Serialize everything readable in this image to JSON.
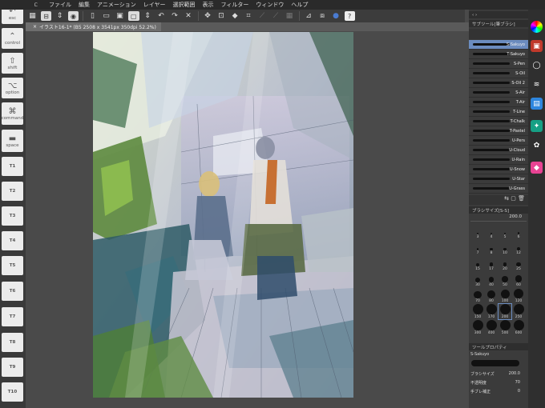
{
  "menubar": {
    "items": [
      "ファイル",
      "編集",
      "アニメーション",
      "レイヤー",
      "選択範囲",
      "表示",
      "フィルター",
      "ウィンドウ",
      "ヘルプ"
    ]
  },
  "document": {
    "tab_title": "イラスト16-1* (B5 2508 x 3541px 350dpi 52.2%)",
    "close": "×"
  },
  "leftbar": {
    "keys": [
      {
        "icon": "↶",
        "label": "esc"
      },
      {
        "icon": "⌃",
        "label": "control"
      },
      {
        "icon": "⇧",
        "label": "shift"
      },
      {
        "icon": "⌥",
        "label": "option"
      },
      {
        "icon": "⌘",
        "label": "command"
      },
      {
        "icon": "▬",
        "label": "space"
      },
      {
        "icon": "",
        "label": "T1"
      },
      {
        "icon": "",
        "label": "T2"
      },
      {
        "icon": "",
        "label": "T3"
      },
      {
        "icon": "",
        "label": "T4"
      },
      {
        "icon": "",
        "label": "T5"
      },
      {
        "icon": "",
        "label": "T6"
      },
      {
        "icon": "",
        "label": "T7"
      },
      {
        "icon": "",
        "label": "T8"
      },
      {
        "icon": "",
        "label": "T9"
      },
      {
        "icon": "",
        "label": "T10"
      }
    ]
  },
  "sub_tool_panel": {
    "title": "サブツール[筆ブラシ]",
    "brushes": [
      "S-Sakuyo",
      "T-Sakuyo",
      "S-Pen",
      "S-Oil",
      "S-Oil 2",
      "S-Air",
      "T-Air",
      "T-Line",
      "T-Chalk",
      "T-Pastel",
      "U-Pers",
      "U-Cloud",
      "U-Rain",
      "U-Snow",
      "U-Star",
      "U-Grass"
    ],
    "selected_index": 0
  },
  "brush_size_panel": {
    "title": "ブラシサイズ[S-S]",
    "value": "200.0",
    "sizes": [
      "3",
      "4",
      "5",
      "6",
      "7",
      "8",
      "10",
      "12",
      "15",
      "17",
      "20",
      "25",
      "30",
      "40",
      "50",
      "60",
      "70",
      "80",
      "100",
      "120",
      "150",
      "170",
      "200",
      "250",
      "300",
      "400",
      "500",
      "600"
    ],
    "selected": "200"
  },
  "tool_property_panel": {
    "title": "ツールプロパティ",
    "brush_name": "S-Sakuyo",
    "rows": [
      {
        "label": "ブラシサイズ",
        "value": "200.0"
      },
      {
        "label": "不透明度",
        "value": "70"
      },
      {
        "label": "手ブレ補正",
        "value": "0"
      }
    ]
  },
  "colors": {
    "accent": "#6b8cbf",
    "bg": "#4a4a4a"
  }
}
